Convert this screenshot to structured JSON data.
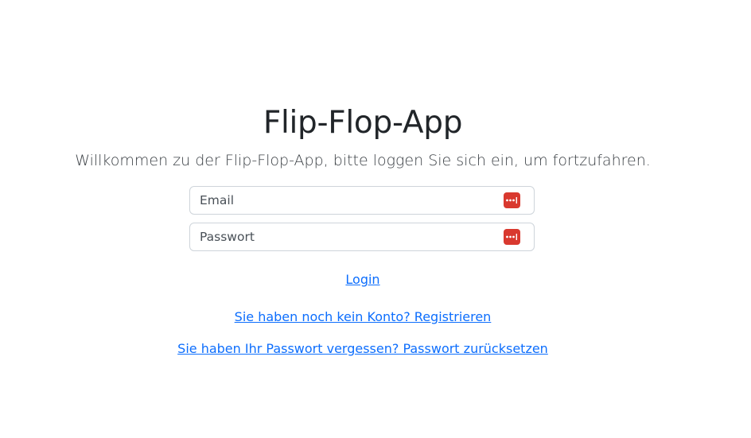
{
  "header": {
    "title": "Flip-Flop-App",
    "subtitle": "Willkommen zu der Flip-Flop-App, bitte loggen Sie sich ein, um fortzufahren."
  },
  "form": {
    "email": {
      "placeholder": "Email",
      "value": ""
    },
    "password": {
      "placeholder": "Passwort",
      "value": ""
    },
    "field_icon": "password-manager-icon"
  },
  "links": {
    "login": "Login",
    "register": "Sie haben noch kein Konto? Registrieren",
    "reset": "Sie haben Ihr Passwort vergessen? Passwort zurücksetzen"
  },
  "colors": {
    "link": "#0d6efd",
    "icon_bg": "#d9392f",
    "border": "#ced4da"
  }
}
